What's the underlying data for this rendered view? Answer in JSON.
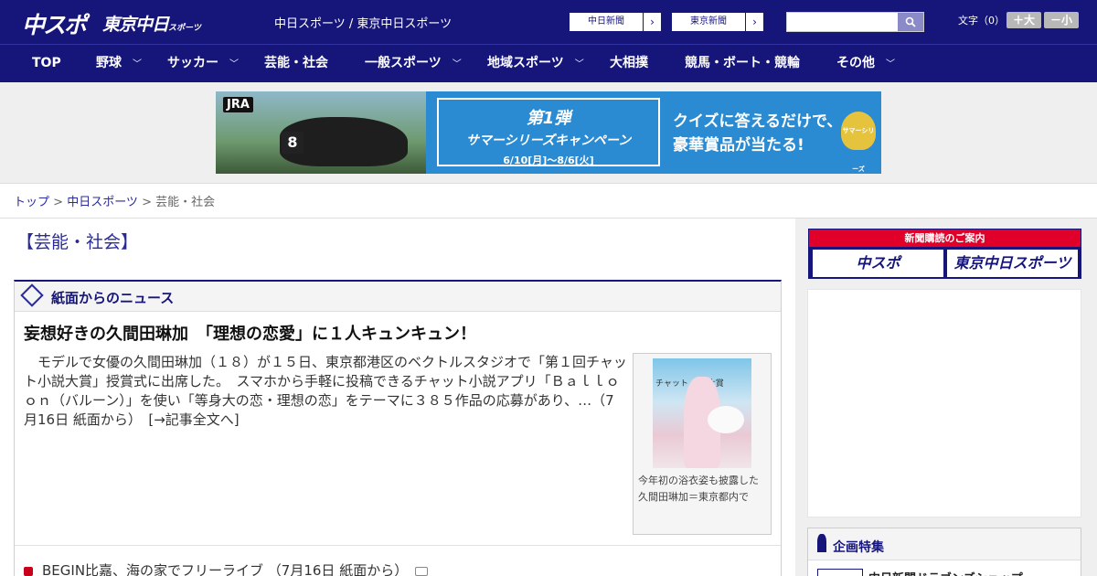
{
  "header": {
    "logo_chuspo": "中スポ",
    "logo_tokyo": "東京中日",
    "logo_tokyo_suffix": "スポーツ",
    "links": "中日スポーツ / 東京中日スポーツ",
    "paper1": "中日新聞",
    "paper2": "東京新聞",
    "search_placeholder": "",
    "font_label": "文字（0）",
    "font_plus": "＋大",
    "font_minus": "－小"
  },
  "nav": [
    {
      "label": "TOP",
      "has_menu": false
    },
    {
      "label": "野球",
      "has_menu": true
    },
    {
      "label": "サッカー",
      "has_menu": true
    },
    {
      "label": "芸能・社会",
      "has_menu": false
    },
    {
      "label": "一般スポーツ",
      "has_menu": true
    },
    {
      "label": "地域スポーツ",
      "has_menu": true
    },
    {
      "label": "大相撲",
      "has_menu": false
    },
    {
      "label": "競馬・ボート・競輪",
      "has_menu": false
    },
    {
      "label": "その他",
      "has_menu": true
    }
  ],
  "banner": {
    "jra": "JRA",
    "horse_number": "8",
    "campaign_line1": "第1弾",
    "campaign_line2": "サマーシリーズキャンペーン",
    "campaign_dates": "6/10[月]～8/6[火]",
    "quiz_line1": "クイズに答えるだけで、",
    "quiz_line2": "豪華賞品が当たる!",
    "badge": "サマーシリーズ"
  },
  "breadcrumb": {
    "top": "トップ",
    "chunichi": "中日スポーツ",
    "current": "芸能・社会",
    "sep": " > "
  },
  "page_title": "【芸能・社会】",
  "news": {
    "section_title": "紙面からのニュース",
    "headline": "妄想好きの久間田琳加　「理想の恋愛」に１人キュンキュン！",
    "body": "　モデルで女優の久間田琳加（１８）が１５日、東京都港区のベクトルスタジオで「第１回チャット小説大賞」授賞式に出席した。　スマホから手軽に投稿できるチャット小説アプリ「Ｂａｌｌｏｏｎ（バルーン）」を使い「等身大の恋・理想の恋」をテーマに３８５作品の応募があり、…（7月16日 紙面から）　[→記事全文へ]",
    "photo_sign": "チャット 小説大賞",
    "photo_caption": "今年初の浴衣姿も披露した久間田琳加＝東京都内で",
    "item2": "BEGIN比嘉、海の家でフリーライブ （7月16日 紙面から）"
  },
  "sidebar": {
    "subscribe_band": "新聞購読のご案内",
    "subscribe_btn1": "中スポ",
    "subscribe_btn2": "東京中日スポーツ",
    "feature_title": "企画特集",
    "feature_item": "中日新聞ドラゴンズショップ"
  }
}
